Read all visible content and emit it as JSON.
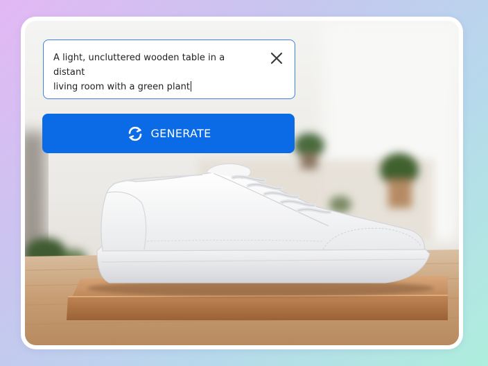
{
  "prompt": {
    "value": "A light, uncluttered wooden table in a distant living room with a green plant",
    "line1": "A light, uncluttered wooden table in a distant",
    "line2": "living room with a green plant"
  },
  "icons": {
    "clear": "close-icon",
    "generate": "refresh-arrows-icon"
  },
  "generate_button": {
    "label": "GENERATE"
  },
  "colors": {
    "accent": "#0b6be6",
    "input_border": "#3d7fe6",
    "card": "#ffffff"
  }
}
